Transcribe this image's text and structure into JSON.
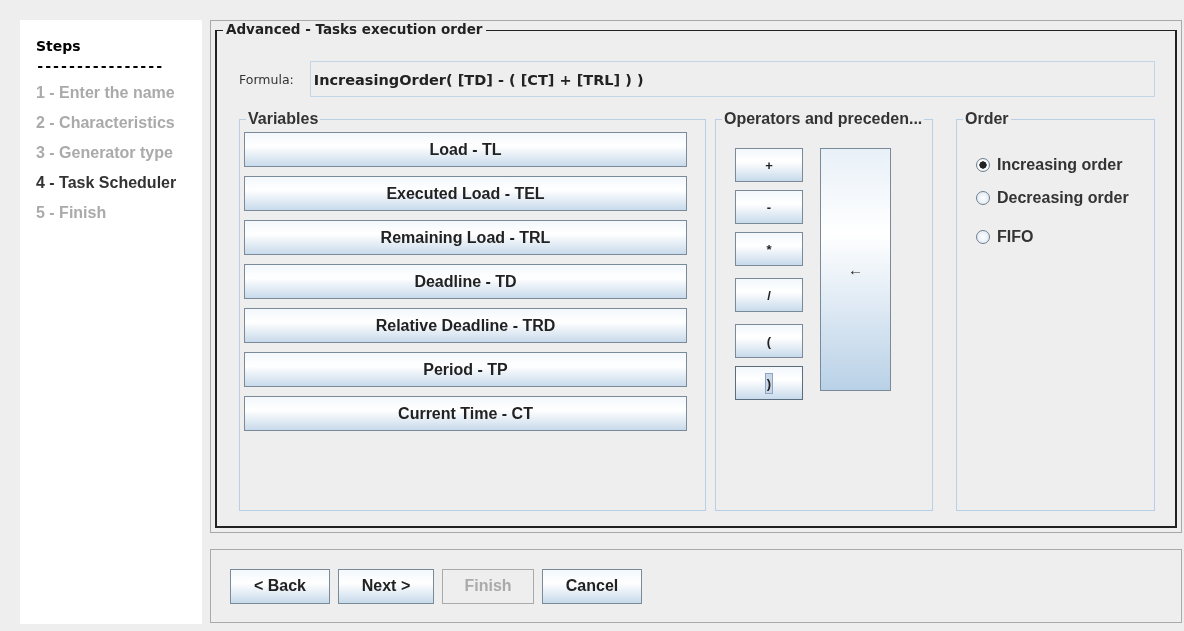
{
  "steps": {
    "title": "Steps",
    "divider": "----------------",
    "items": [
      {
        "label": "1 - Enter the name",
        "selected": false
      },
      {
        "label": "2 - Characteristics",
        "selected": false
      },
      {
        "label": "3 - Generator type",
        "selected": false
      },
      {
        "label": "4 - Task Scheduler",
        "selected": true
      },
      {
        "label": "5 - Finish",
        "selected": false
      }
    ]
  },
  "panel": {
    "title": "Advanced - Tasks execution order",
    "formula": {
      "label": "Formula:",
      "value": "IncreasingOrder( [TD] - ( [CT] + [TRL] ) )"
    },
    "variables": {
      "title": "Variables",
      "buttons": [
        "Load - TL",
        "Executed Load - TEL",
        "Remaining Load - TRL",
        "Deadline - TD",
        "Relative Deadline - TRD",
        "Period - TP",
        "Current Time - CT"
      ]
    },
    "operators": {
      "title": "Operators and preceden...",
      "buttons": [
        {
          "label": "+",
          "focused": false
        },
        {
          "label": "-",
          "focused": false
        },
        {
          "label": "*",
          "focused": false
        },
        {
          "label": "/",
          "focused": false
        },
        {
          "label": "(",
          "focused": false
        },
        {
          "label": ")",
          "focused": true
        }
      ],
      "backspace": "←"
    },
    "order": {
      "title": "Order",
      "options": [
        {
          "label": "Increasing order",
          "selected": true
        },
        {
          "label": "Decreasing order",
          "selected": false
        },
        {
          "label": "FIFO",
          "selected": false
        }
      ]
    }
  },
  "buttons": [
    {
      "label": "< Back",
      "disabled": false
    },
    {
      "label": "Next >",
      "disabled": false
    },
    {
      "label": "Finish",
      "disabled": true
    },
    {
      "label": "Cancel",
      "disabled": false
    }
  ]
}
